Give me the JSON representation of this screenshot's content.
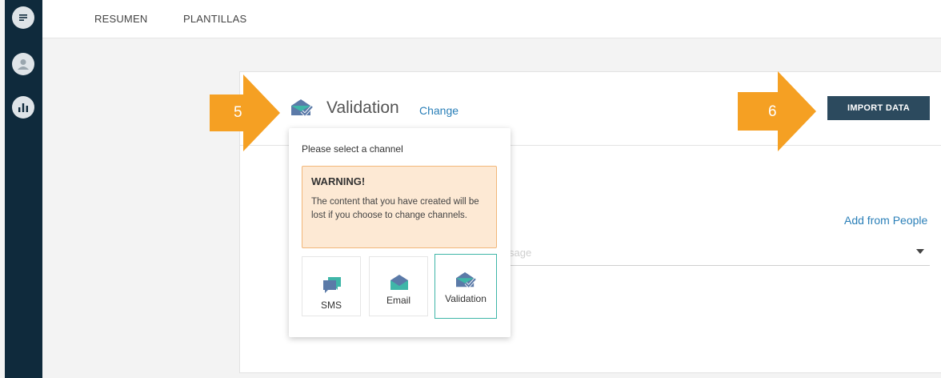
{
  "sidebar": {
    "icons": [
      "chat-bubble-icon",
      "user-avatar-icon",
      "stats-chart-icon"
    ]
  },
  "topnav": {
    "tabs": [
      {
        "label": "RESUMEN"
      },
      {
        "label": "PLANTILLAS"
      }
    ]
  },
  "header": {
    "channel_title": "Validation",
    "change_link": "Change",
    "import_button": "IMPORT DATA"
  },
  "body": {
    "add_from_people": "Add from People",
    "select_placeholder_fragment": "sage"
  },
  "annotations": {
    "step_a": "5",
    "step_b": "6",
    "color": "#f5a023"
  },
  "popup": {
    "title": "Please select a channel",
    "warning_title": "WARNING!",
    "warning_text": "The content that you have created will be lost if you choose to change channels.",
    "channels": [
      {
        "label": "SMS",
        "icon": "sms-chat-icon",
        "selected": false
      },
      {
        "label": "Email",
        "icon": "email-envelope-icon",
        "selected": false
      },
      {
        "label": "Validation",
        "icon": "validation-envelope-icon",
        "selected": true
      }
    ]
  },
  "colors": {
    "sidebar": "#0f2a3c",
    "primary_button": "#2c4a5e",
    "link": "#2a7fb8",
    "selected_border": "#3fb6a8",
    "warning_bg": "#fde9d4",
    "warning_border": "#f2b779"
  }
}
